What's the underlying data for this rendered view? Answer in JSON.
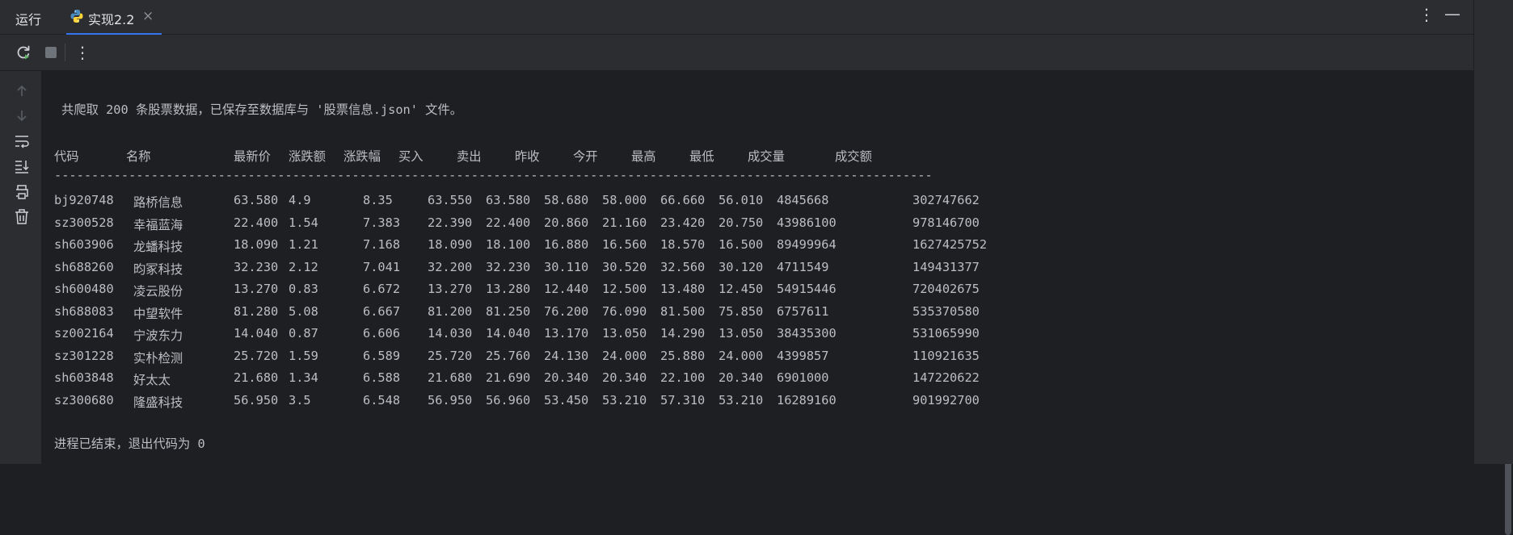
{
  "topbar": {
    "title": "运行",
    "tab_label": "实现2.2",
    "close_glyph": "×",
    "more_glyph": "⋮",
    "minimize_glyph": "—"
  },
  "toolbar": {
    "more_glyph": "⋮"
  },
  "icons": {
    "tab": "python-icon",
    "rerun": "rerun-icon",
    "stop": "stop-icon",
    "gutter": [
      "arrow-up-icon",
      "arrow-down-icon",
      "soft-wrap-icon",
      "scroll-to-end-icon",
      "print-icon",
      "trash-icon"
    ]
  },
  "console": {
    "summary": "共爬取 200 条股票数据，已保存至数据库与 '股票信息.json' 文件。",
    "headers": [
      "代码",
      "名称",
      "最新价",
      "涨跌额",
      "涨跌幅",
      "买入",
      "卖出",
      "昨收",
      "今开",
      "最高",
      "最低",
      "成交量",
      "成交额"
    ],
    "divider": "----------------------------------------------------------------------------------------------------------------------",
    "rows": [
      [
        "bj920748",
        "路桥信息",
        "63.580",
        "4.9",
        "8.35",
        "63.550",
        "63.580",
        "58.680",
        "58.000",
        "66.660",
        "56.010",
        "4845668",
        "302747662"
      ],
      [
        "sz300528",
        "幸福蓝海",
        "22.400",
        "1.54",
        "7.383",
        "22.390",
        "22.400",
        "20.860",
        "21.160",
        "23.420",
        "20.750",
        "43986100",
        "978146700"
      ],
      [
        "sh603906",
        "龙蟠科技",
        "18.090",
        "1.21",
        "7.168",
        "18.090",
        "18.100",
        "16.880",
        "16.560",
        "18.570",
        "16.500",
        "89499964",
        "1627425752"
      ],
      [
        "sh688260",
        "昀冢科技",
        "32.230",
        "2.12",
        "7.041",
        "32.200",
        "32.230",
        "30.110",
        "30.520",
        "32.560",
        "30.120",
        "4711549",
        "149431377"
      ],
      [
        "sh600480",
        "凌云股份",
        "13.270",
        "0.83",
        "6.672",
        "13.270",
        "13.280",
        "12.440",
        "12.500",
        "13.480",
        "12.450",
        "54915446",
        "720402675"
      ],
      [
        "sh688083",
        "中望软件",
        "81.280",
        "5.08",
        "6.667",
        "81.200",
        "81.250",
        "76.200",
        "76.090",
        "81.500",
        "75.850",
        "6757611",
        "535370580"
      ],
      [
        "sz002164",
        "宁波东力",
        "14.040",
        "0.87",
        "6.606",
        "14.030",
        "14.040",
        "13.170",
        "13.050",
        "14.290",
        "13.050",
        "38435300",
        "531065990"
      ],
      [
        "sz301228",
        "实朴检测",
        "25.720",
        "1.59",
        "6.589",
        "25.720",
        "25.760",
        "24.130",
        "24.000",
        "25.880",
        "24.000",
        "4399857",
        "110921635"
      ],
      [
        "sh603848",
        "好太太",
        "21.680",
        "1.34",
        "6.588",
        "21.680",
        "21.690",
        "20.340",
        "20.340",
        "22.100",
        "20.340",
        "6901000",
        "147220622"
      ],
      [
        "sz300680",
        "隆盛科技",
        "56.950",
        "3.5",
        "6.548",
        "56.950",
        "56.960",
        "53.450",
        "53.210",
        "57.310",
        "53.210",
        "16289160",
        "901992700"
      ]
    ],
    "exit_message": "进程已结束，退出代码为 0"
  }
}
